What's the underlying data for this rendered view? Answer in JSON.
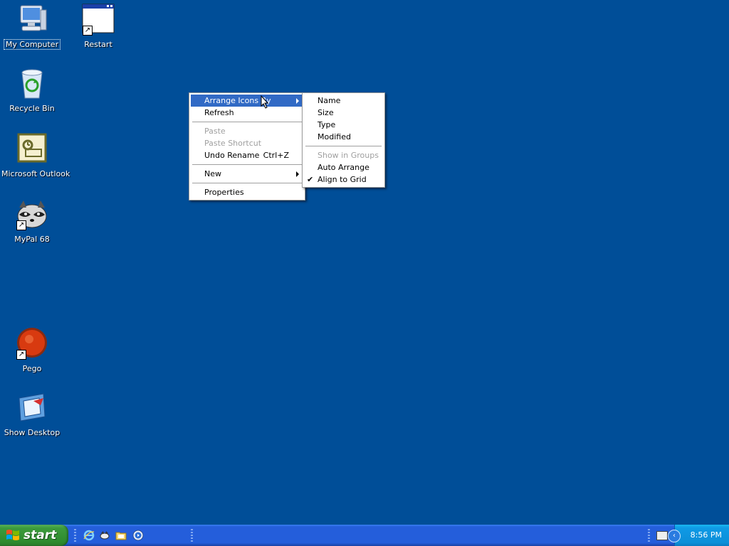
{
  "desktop": {
    "background": "#004e98",
    "icons": [
      {
        "label": "My Computer",
        "icon": "computer-icon"
      },
      {
        "label": "Restart",
        "icon": "window-icon"
      },
      {
        "label": "Recycle Bin",
        "icon": "recycle-bin-icon"
      },
      {
        "label": "Microsoft Outlook",
        "icon": "outlook-icon"
      },
      {
        "label": "MyPal 68",
        "icon": "raccoon-icon"
      },
      {
        "label": "Pego",
        "icon": "red-ball-icon"
      },
      {
        "label": "Show Desktop",
        "icon": "show-desktop-icon"
      }
    ]
  },
  "context_menu": {
    "items": [
      {
        "label": "Arrange Icons By",
        "highlighted": true,
        "submenu": true
      },
      {
        "label": "Refresh"
      },
      {
        "label": "Paste",
        "disabled": true
      },
      {
        "label": "Paste Shortcut",
        "disabled": true
      },
      {
        "label": "Undo Rename",
        "shortcut": "Ctrl+Z"
      },
      {
        "label": "New",
        "submenu": true
      },
      {
        "label": "Properties"
      }
    ]
  },
  "submenu": {
    "items": [
      {
        "label": "Name"
      },
      {
        "label": "Size"
      },
      {
        "label": "Type"
      },
      {
        "label": "Modified"
      },
      {
        "label": "Show in Groups",
        "disabled": true
      },
      {
        "label": "Auto Arrange"
      },
      {
        "label": "Align to Grid",
        "checked": true
      }
    ],
    "check_glyph": "✔"
  },
  "taskbar": {
    "start_label": "start",
    "quick_launch": [
      "internet-explorer-icon",
      "media-icon",
      "folder-icon",
      "media-player-icon"
    ],
    "clock": "8:56 PM",
    "tray_chevron": "‹"
  },
  "colors": {
    "menu_highlight": "#316ac5",
    "taskbar": "#245edb",
    "start_button": "#3c9b3c",
    "tray": "#0f9ae6"
  }
}
